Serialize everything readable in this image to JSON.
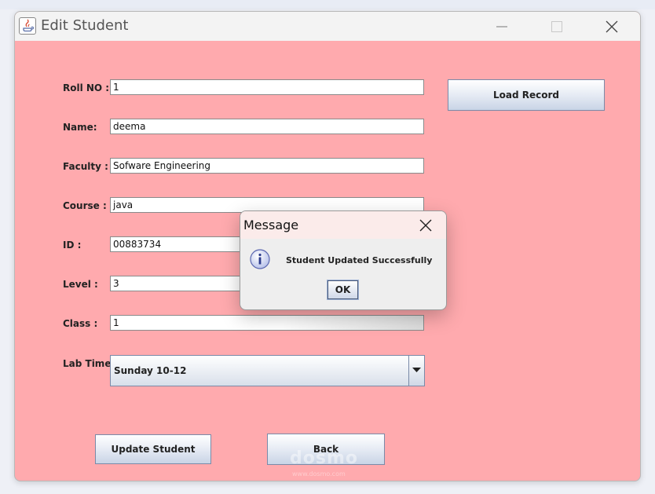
{
  "window": {
    "title": "Edit Student"
  },
  "form": {
    "roll_no_label": "Roll NO :",
    "roll_no_value": "1",
    "name_label": "Name:",
    "name_value": "deema",
    "faculty_label": "Faculty :",
    "faculty_value": "Sofware Engineering",
    "course_label": "Course :",
    "course_value": "java",
    "id_label": "ID :",
    "id_value": "00883734",
    "level_label": "Level :",
    "level_value": "3",
    "class_label": "Class :",
    "class_value": "1",
    "lab_time_label": "Lab Time:",
    "lab_time_selected": "Sunday 10-12"
  },
  "buttons": {
    "load_record": "Load Record",
    "update_student": "Update Student",
    "back": "Back"
  },
  "watermark": {
    "text": "dosmo",
    "sub": "www.dosmo.com"
  },
  "dialog": {
    "title": "Message",
    "message": "Student Updated Successfully",
    "ok_label": "OK"
  },
  "colors": {
    "form_background": "#ffaaae",
    "titlebar": "#f3f3f3",
    "dialog_titlebar": "#fbebea"
  }
}
